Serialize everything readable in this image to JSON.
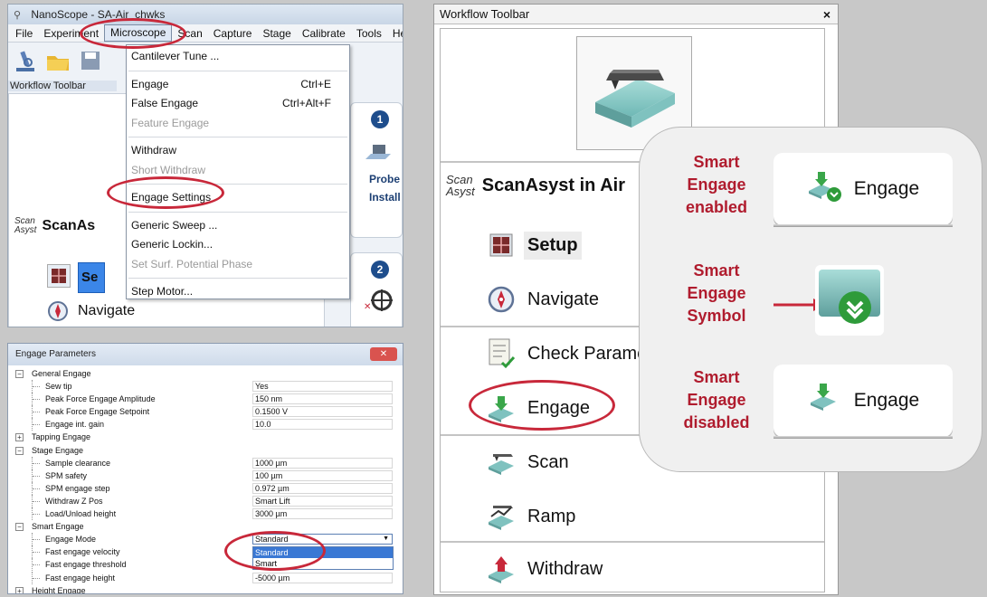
{
  "nanoscope": {
    "title": "NanoScope - SA-Air_chwks",
    "menus": [
      "File",
      "Experiment",
      "Microscope",
      "Scan",
      "Capture",
      "Stage",
      "Calibrate",
      "Tools",
      "He"
    ],
    "workflow_label": "Workflow Toolbar",
    "scan_logo_line1": "Scan",
    "scan_logo_line2": "Asyst",
    "sa_name": "ScanAs",
    "setup_label": "Se",
    "navigate_label": "Navigate",
    "card1_number": "1",
    "card1_line1": "Probe",
    "card1_line2": "Install",
    "card2_number": "2",
    "microscope_menu": {
      "cantilever_tune": "Cantilever Tune ...",
      "engage": "Engage",
      "engage_shortcut": "Ctrl+E",
      "false_engage": "False Engage",
      "false_engage_shortcut": "Ctrl+Alt+F",
      "feature_engage": "Feature Engage",
      "withdraw": "Withdraw",
      "short_withdraw": "Short Withdraw",
      "engage_settings": "Engage Settings",
      "generic_sweep": "Generic Sweep ...",
      "generic_lockin": "Generic Lockin...",
      "set_surf": "Set Surf. Potential Phase",
      "step_motor": "Step Motor..."
    }
  },
  "engage_params": {
    "title": "Engage Parameters",
    "close": "✕",
    "rows": {
      "general_engage": "General Engage",
      "sew_tip": "Sew tip",
      "sew_tip_val": "Yes",
      "pf_amp": "Peak Force Engage Amplitude",
      "pf_amp_val": "150 nm",
      "pf_set": "Peak Force Engage Setpoint",
      "pf_set_val": "0.1500 V",
      "int_gain": "Engage int. gain",
      "int_gain_val": "10.0",
      "tapping": "Tapping Engage",
      "stage": "Stage Engage",
      "sample_clear": "Sample clearance",
      "sample_clear_val": "1000 µm",
      "spm_safety": "SPM safety",
      "spm_safety_val": "100 µm",
      "spm_step": "SPM engage step",
      "spm_step_val": "0.972 µm",
      "withdraw_z": "Withdraw Z Pos",
      "withdraw_z_val": "Smart Lift",
      "load_unload": "Load/Unload height",
      "load_unload_val": "3000 µm",
      "smart": "Smart Engage",
      "mode": "Engage Mode",
      "mode_val": "Standard",
      "fast_vel": "Fast engage velocity",
      "fast_thr": "Fast engage threshold",
      "fast_height": "Fast engage height",
      "fast_height_val": "-5000 µm",
      "height_engage": "Height Engage"
    },
    "mode_options": [
      "Standard",
      "Smart"
    ]
  },
  "workflow": {
    "title": "Workflow Toolbar",
    "close": "×",
    "scan_logo_line1": "Scan",
    "scan_logo_line2": "Asyst",
    "sa_name": "ScanAsyst in Air",
    "items": {
      "setup": "Setup",
      "navigate": "Navigate",
      "check_params": "Check Parame",
      "engage": "Engage",
      "scan": "Scan",
      "ramp": "Ramp",
      "withdraw": "Withdraw"
    }
  },
  "callout": {
    "enabled_label": [
      "Smart",
      "Engage",
      "enabled"
    ],
    "symbol_label": [
      "Smart",
      "Engage",
      "Symbol"
    ],
    "disabled_label": [
      "Smart",
      "Engage",
      "disabled"
    ],
    "engage_text": "Engage"
  },
  "colors": {
    "highlight_red": "#c8283a",
    "label_red": "#b01c2e",
    "blue_select": "#3b86e8"
  }
}
